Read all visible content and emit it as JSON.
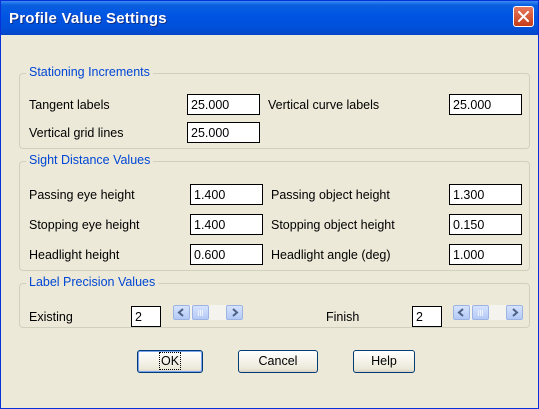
{
  "window": {
    "title": "Profile Value Settings"
  },
  "stationing": {
    "legend": "Stationing Increments",
    "tangent_label": "Tangent labels",
    "tangent_value": "25.000",
    "vcurve_label": "Vertical curve labels",
    "vcurve_value": "25.000",
    "grid_label": "Vertical grid lines",
    "grid_value": "25.000"
  },
  "sight": {
    "legend": "Sight Distance Values",
    "passing_eye_label": "Passing eye height",
    "passing_eye_value": "1.400",
    "passing_obj_label": "Passing object height",
    "passing_obj_value": "1.300",
    "stopping_eye_label": "Stopping eye height",
    "stopping_eye_value": "1.400",
    "stopping_obj_label": "Stopping object height",
    "stopping_obj_value": "0.150",
    "headlight_height_label": "Headlight height",
    "headlight_height_value": "0.600",
    "headlight_angle_label": "Headlight angle (deg)",
    "headlight_angle_value": "1.000"
  },
  "precision": {
    "legend": "Label Precision Values",
    "existing_label": "Existing",
    "existing_value": "2",
    "finish_label": "Finish",
    "finish_value": "2"
  },
  "buttons": {
    "ok": "OK",
    "cancel": "Cancel",
    "help": "Help"
  }
}
